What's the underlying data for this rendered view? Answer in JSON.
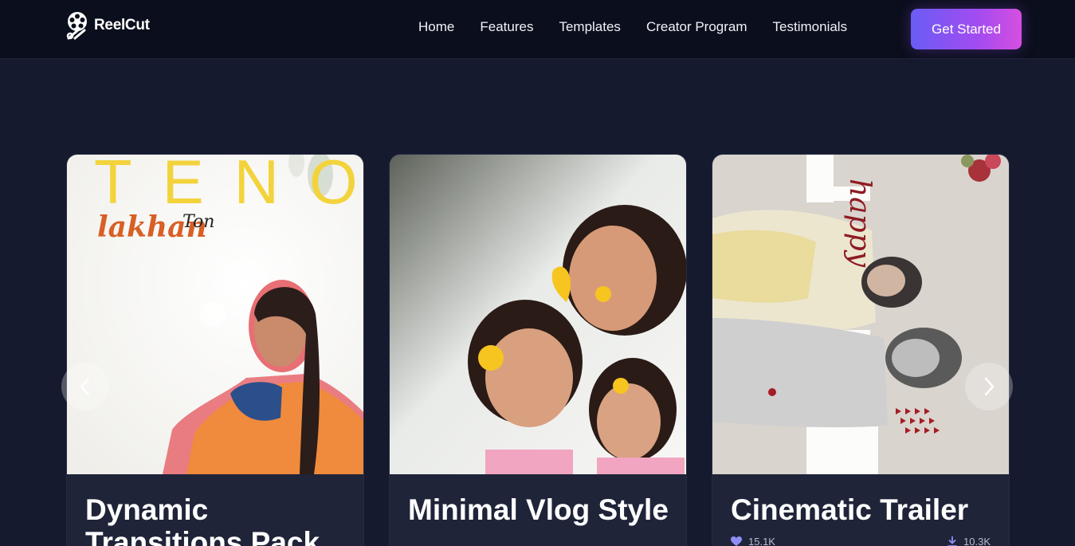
{
  "brand": {
    "name": "ReelCut",
    "accent": "#8b5cf6"
  },
  "nav": {
    "links": [
      "Home",
      "Features",
      "Templates",
      "Creator Program",
      "Testimonials"
    ],
    "cta": "Get Started"
  },
  "carousel": {
    "prev_icon": "chevron-left-icon",
    "next_icon": "chevron-right-icon",
    "cards": [
      {
        "title": "Dynamic Transitions Pack",
        "poster_text_top": "TENO",
        "poster_text_script": "lakhan",
        "poster_text_small": "Ton"
      },
      {
        "title": "Minimal Vlog Style"
      },
      {
        "title": "Cinematic Trailer",
        "poster_text_script": "happy",
        "likes": "15.1K",
        "downloads": "10.3K"
      }
    ]
  }
}
